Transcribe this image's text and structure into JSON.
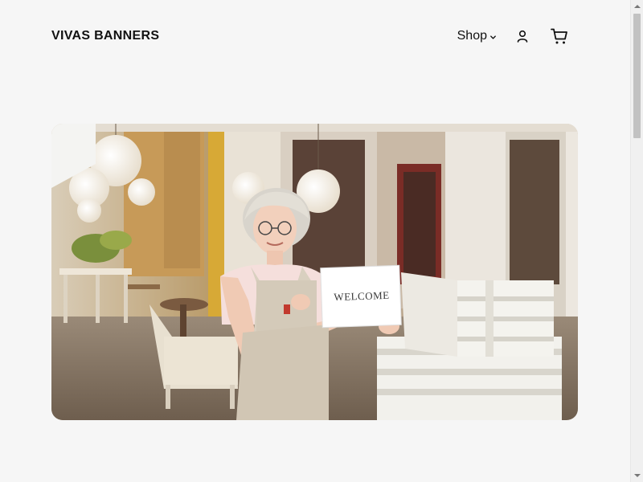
{
  "header": {
    "brand": "VIVAS BANNERS",
    "nav": {
      "shop_label": "Shop",
      "account_icon": "user-icon",
      "cart_icon": "cart-icon"
    }
  },
  "hero": {
    "sign_text": "WELCOME"
  },
  "colors": {
    "background": "#f6f6f6",
    "text": "#111111"
  }
}
